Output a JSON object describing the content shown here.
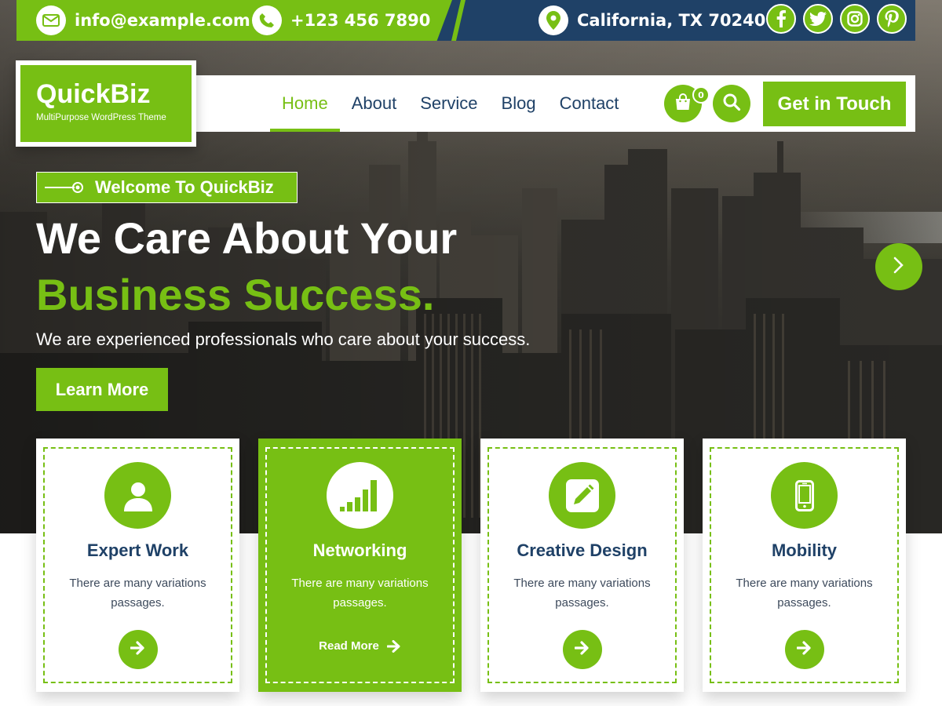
{
  "colors": {
    "accent": "#77bf14",
    "navy": "#1f4167",
    "white": "#ffffff"
  },
  "topbar": {
    "email": "info@example.com",
    "phone": "+123 456 7890",
    "location": "California, TX 70240",
    "email_icon": "envelope-icon",
    "phone_icon": "phone-icon",
    "location_icon": "map-pin-icon",
    "social": [
      "facebook-icon",
      "twitter-icon",
      "instagram-icon",
      "pinterest-icon"
    ]
  },
  "logo": {
    "title": "QuickBiz",
    "subtitle": "MultiPurpose WordPress Theme"
  },
  "nav": {
    "items": [
      {
        "label": "Home",
        "active": true
      },
      {
        "label": "About"
      },
      {
        "label": "Service"
      },
      {
        "label": "Blog"
      },
      {
        "label": "Contact"
      }
    ],
    "cart_count": "0",
    "cta_label": "Get in Touch"
  },
  "hero": {
    "welcome": "Welcome To QuickBiz",
    "headline_line1": "We Care About Your",
    "headline_line2": "Business Success.",
    "description": "We are experienced professionals who care about your success.",
    "button_label": "Learn More"
  },
  "cards": [
    {
      "title": "Expert Work",
      "text": "There are many variations passages.",
      "icon": "user-icon"
    },
    {
      "title": "Networking",
      "text": "There are many variations passages.",
      "icon": "signal-bars-icon",
      "link_label": "Read More"
    },
    {
      "title": "Creative Design",
      "text": "There are many variations passages.",
      "icon": "edit-icon"
    },
    {
      "title": "Mobility",
      "text": "There are many variations passages.",
      "icon": "mobile-icon"
    }
  ]
}
